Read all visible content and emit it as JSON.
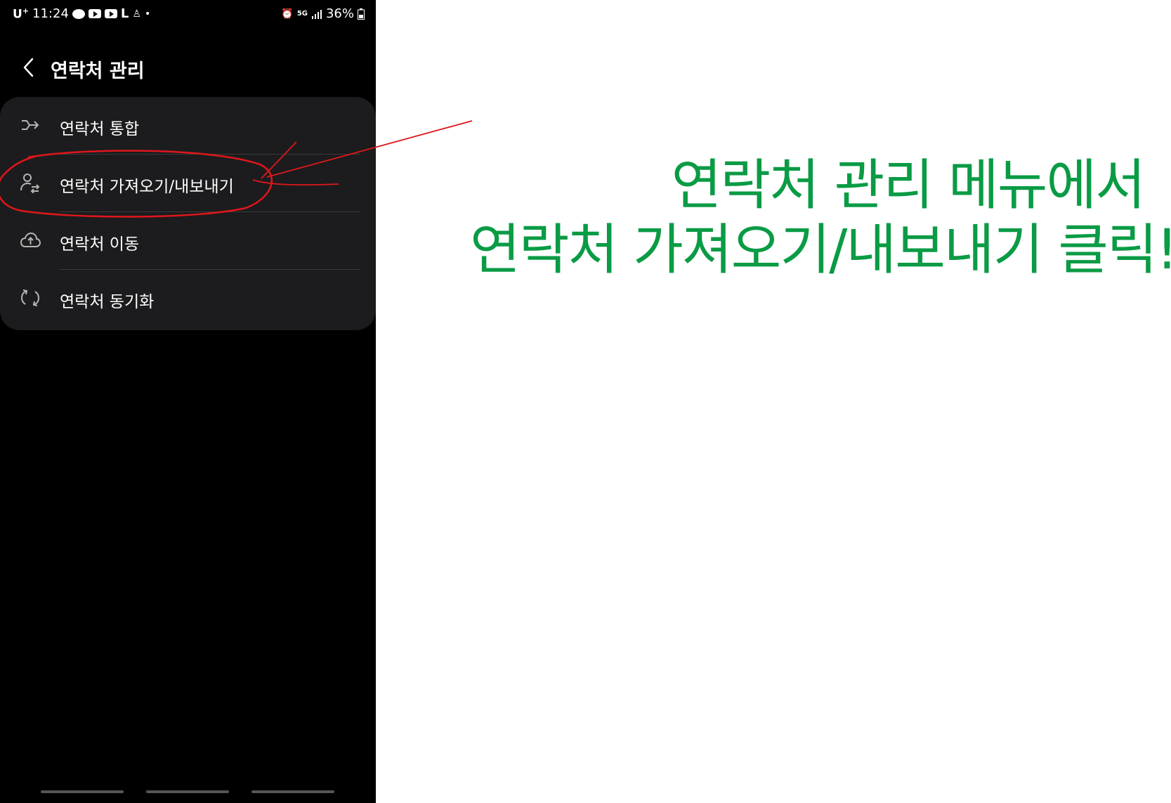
{
  "status_bar": {
    "carrier": "U",
    "carrier_sup": "+",
    "time": "11:24",
    "network": "5G",
    "battery": "36%"
  },
  "header": {
    "title": "연락처 관리"
  },
  "menu": {
    "items": [
      {
        "label": "연락처 통합",
        "icon": "merge-icon"
      },
      {
        "label": "연락처 가져오기/내보내기",
        "icon": "person-transfer-icon"
      },
      {
        "label": "연락처 이동",
        "icon": "cloud-upload-icon"
      },
      {
        "label": "연락처 동기화",
        "icon": "sync-icon"
      }
    ]
  },
  "annotation": {
    "line1": "연락처 관리 메뉴에서",
    "line2": "연락처 가져오기/내보내기 클릭!",
    "text_color": "#0a9b45",
    "mark_color": "#e0161b"
  },
  "colors": {
    "phone_bg": "#000000",
    "card_bg": "#1c1c1e",
    "divider": "#3a3a3c"
  }
}
